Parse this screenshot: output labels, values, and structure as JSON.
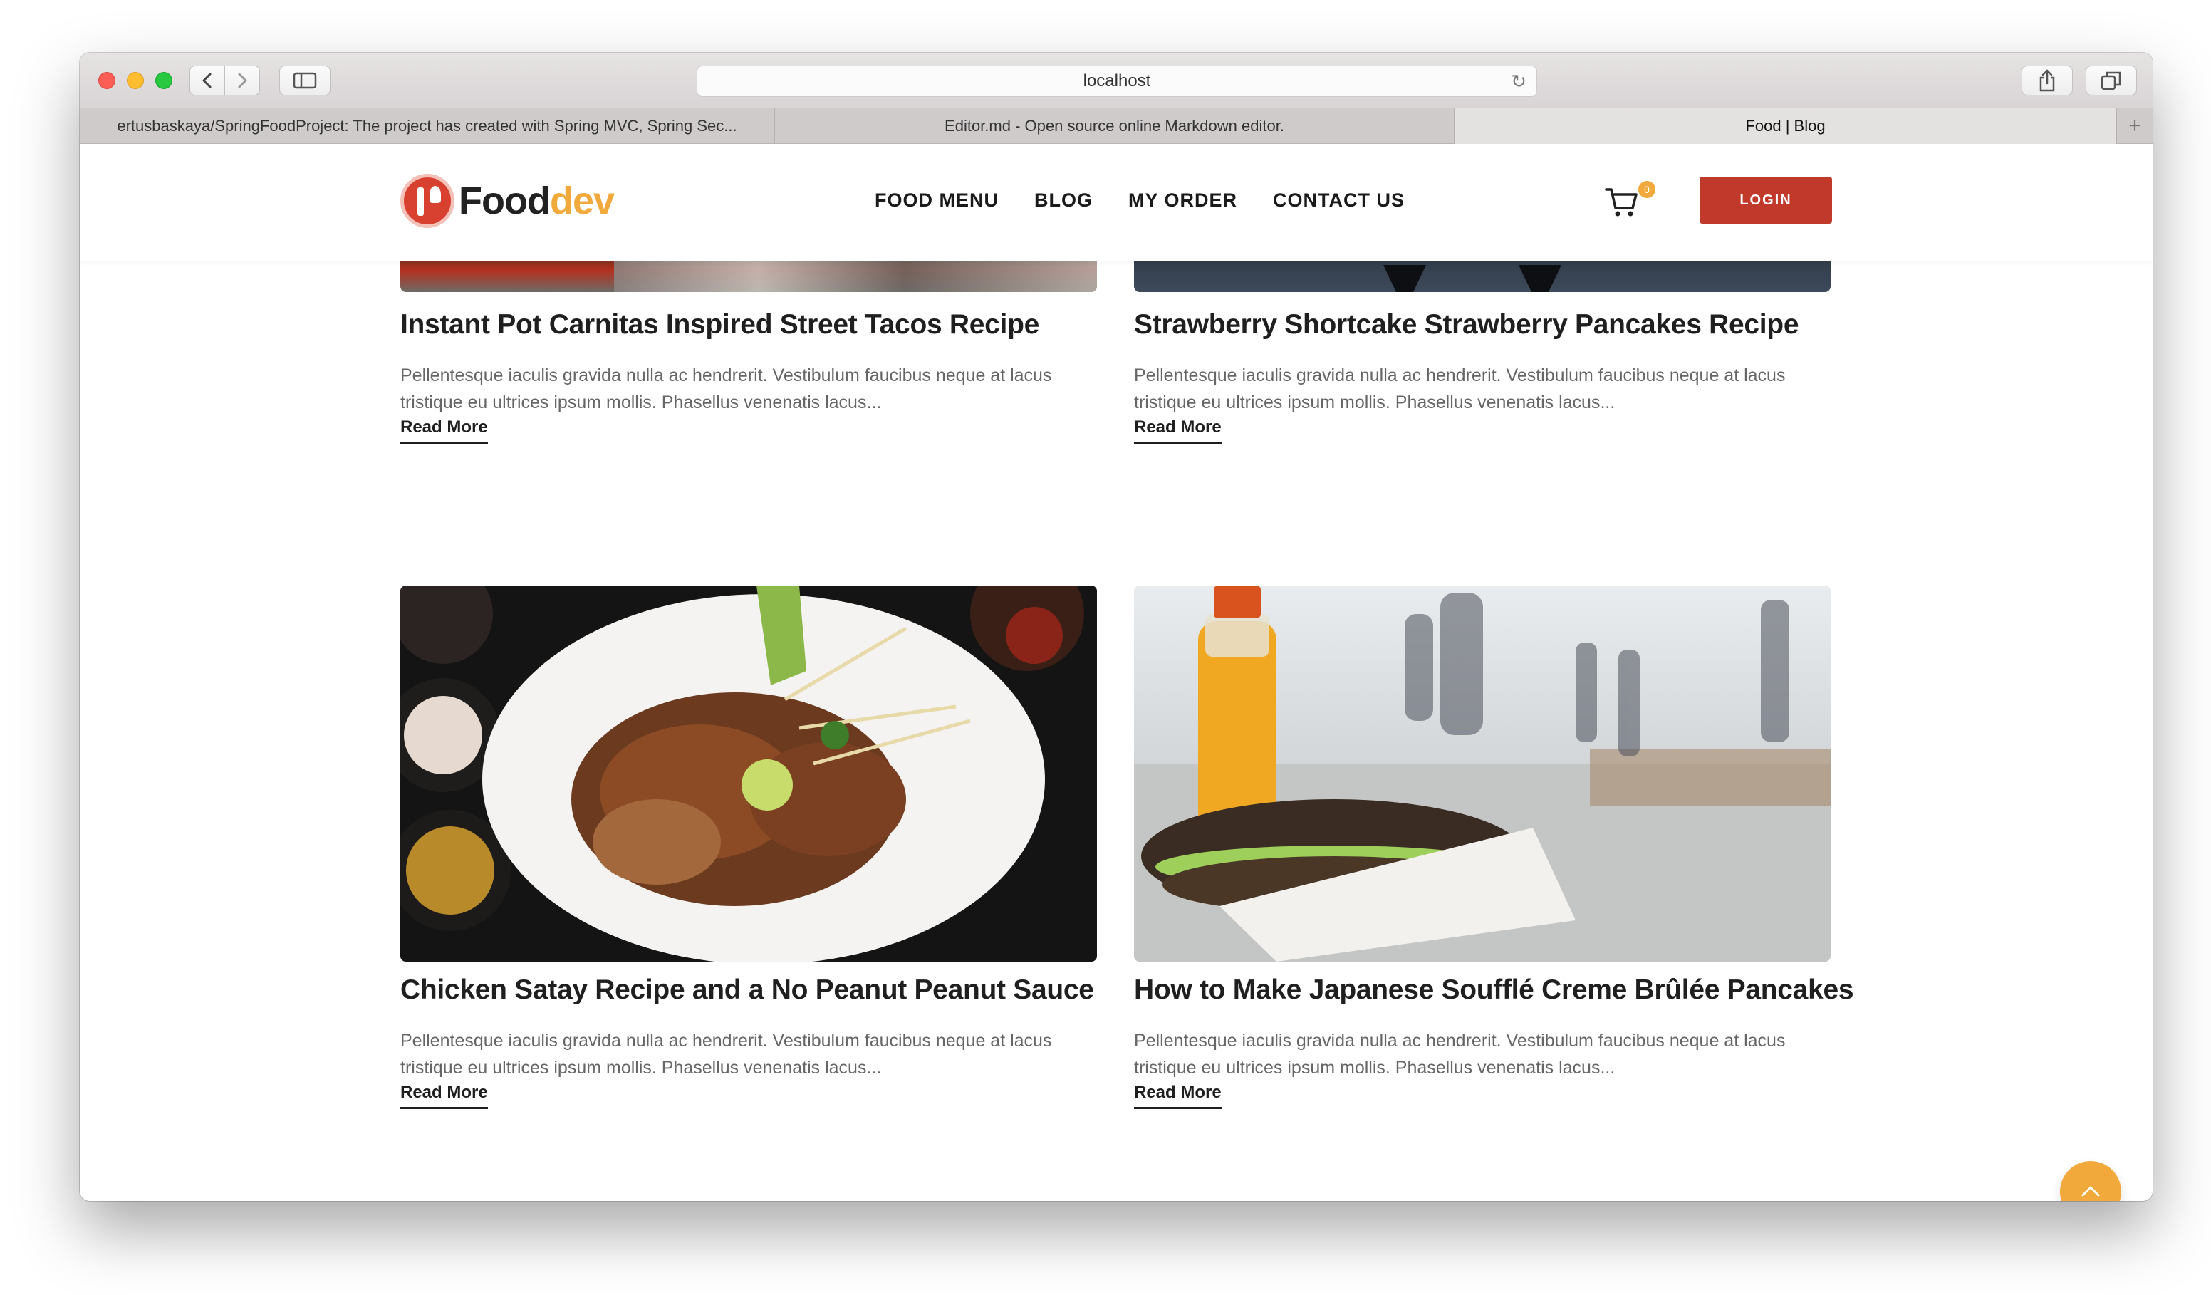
{
  "browser": {
    "address": "localhost",
    "tabs": [
      {
        "label": "ertusbaskaya/SpringFoodProject: The project has created with Spring MVC, Spring Sec..."
      },
      {
        "label": "Editor.md - Open source online Markdown editor."
      },
      {
        "label": "Food | Blog"
      }
    ],
    "new_tab_symbol": "+"
  },
  "header": {
    "logo_part1": "Food",
    "logo_part2": "dev",
    "nav": [
      "FOOD MENU",
      "BLOG",
      "MY ORDER",
      "CONTACT US"
    ],
    "cart_count": "0",
    "login_label": "LOGIN"
  },
  "posts": [
    {
      "title": "Instant Pot Carnitas Inspired Street Tacos Recipe",
      "excerpt": "Pellentesque iaculis gravida nulla ac hendrerit. Vestibulum faucibus neque at lacus tristique eu ultrices ipsum mollis. Phasellus venenatis lacus...",
      "read_more": "Read More"
    },
    {
      "title": "Strawberry Shortcake Strawberry Pancakes Recipe",
      "excerpt": "Pellentesque iaculis gravida nulla ac hendrerit. Vestibulum faucibus neque at lacus tristique eu ultrices ipsum mollis. Phasellus venenatis lacus...",
      "read_more": "Read More"
    },
    {
      "title": "Chicken Satay Recipe and a No Peanut Peanut Sauce",
      "excerpt": "Pellentesque iaculis gravida nulla ac hendrerit. Vestibulum faucibus neque at lacus tristique eu ultrices ipsum mollis. Phasellus venenatis lacus...",
      "read_more": "Read More"
    },
    {
      "title": "How to Make Japanese Soufflé Creme Brûlée Pancakes",
      "excerpt": "Pellentesque iaculis gravida nulla ac hendrerit. Vestibulum faucibus neque at lacus tristique eu ultrices ipsum mollis. Phasellus venenatis lacus...",
      "read_more": "Read More"
    }
  ],
  "colors": {
    "brand_red": "#c0392b",
    "brand_orange": "#f0a93a",
    "text_dark": "#1f1f1f",
    "text_muted": "#666666"
  },
  "icons": {
    "cart": "cart-icon",
    "scroll_top": "chevron-up-icon",
    "reload": "reload-icon",
    "share": "share-icon",
    "tabs_overview": "tabs-icon",
    "sidebar": "sidebar-icon"
  }
}
